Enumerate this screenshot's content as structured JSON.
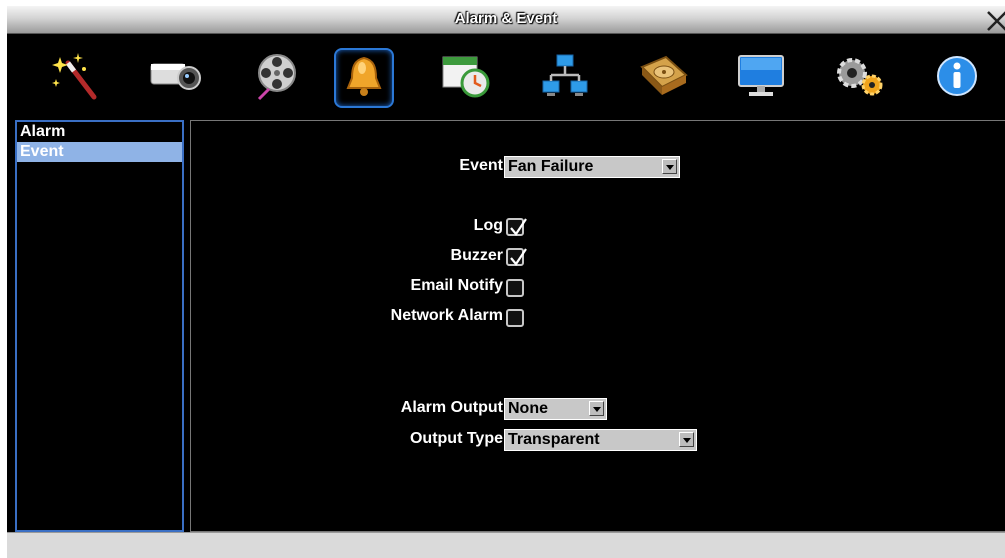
{
  "window": {
    "title": "Alarm & Event"
  },
  "toolbar": {
    "items": [
      {
        "icon": "wizard-wand-icon"
      },
      {
        "icon": "camera-icon"
      },
      {
        "icon": "film-reel-icon"
      },
      {
        "icon": "bell-icon",
        "active": true
      },
      {
        "icon": "schedule-clock-icon"
      },
      {
        "icon": "network-icon"
      },
      {
        "icon": "hard-disk-icon"
      },
      {
        "icon": "monitor-icon"
      },
      {
        "icon": "gears-icon"
      },
      {
        "icon": "info-icon"
      }
    ]
  },
  "sidebar": {
    "items": [
      {
        "label": "Alarm",
        "selected": false
      },
      {
        "label": "Event",
        "selected": true
      }
    ]
  },
  "form": {
    "event": {
      "label": "Event",
      "value": "Fan Failure"
    },
    "log": {
      "label": "Log",
      "checked": true
    },
    "buzzer": {
      "label": "Buzzer",
      "checked": true
    },
    "email_notify": {
      "label": "Email Notify",
      "checked": false
    },
    "network_alarm": {
      "label": "Network Alarm",
      "checked": false
    },
    "alarm_output": {
      "label": "Alarm Output",
      "value": "None"
    },
    "output_type": {
      "label": "Output Type",
      "value": "Transparent"
    }
  },
  "colors": {
    "selection": "#8fb3e6",
    "border_blue": "#3a6fc4",
    "background": "#000000"
  }
}
